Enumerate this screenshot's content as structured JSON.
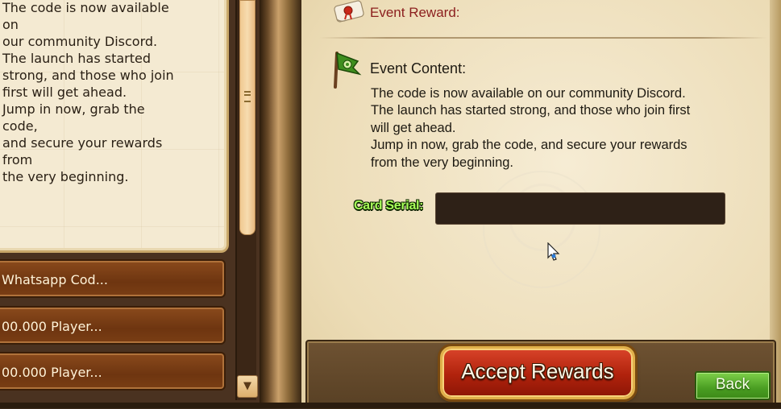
{
  "left_panel": {
    "description_lines": [
      "The code is now available on",
      "our community Discord.",
      "The launch has started",
      "strong, and those who join",
      "first will get ahead.",
      "Jump in now, grab the code,",
      "and secure your rewards from",
      "the very beginning."
    ],
    "events": [
      {
        "label": "Whatsapp Cod..."
      },
      {
        "label": "00.000 Player..."
      },
      {
        "label": "00.000 Player..."
      }
    ],
    "scroll_down_glyph": "▼"
  },
  "detail": {
    "reward_title": "Event Reward:",
    "content_title": "Event Content:",
    "content_lines": [
      "The code is now available on our community Discord.",
      "The launch has started strong, and those who join first",
      "will get ahead.",
      "Jump in now, grab the code, and secure your rewards",
      "from the very beginning."
    ],
    "serial_label": "Card Serial:",
    "serial_value": "",
    "serial_placeholder": ""
  },
  "buttons": {
    "accept": "Accept Rewards",
    "back": "Back"
  },
  "icons": {
    "reward": "scroll-seal-icon",
    "content": "green-flag-icon",
    "cursor": "mouse-pointer-icon"
  },
  "colors": {
    "reward_title": "#8b1e1e",
    "serial_label": "#a8ff5a",
    "accept_button": "#b0220c",
    "back_button": "#4a9e22"
  }
}
